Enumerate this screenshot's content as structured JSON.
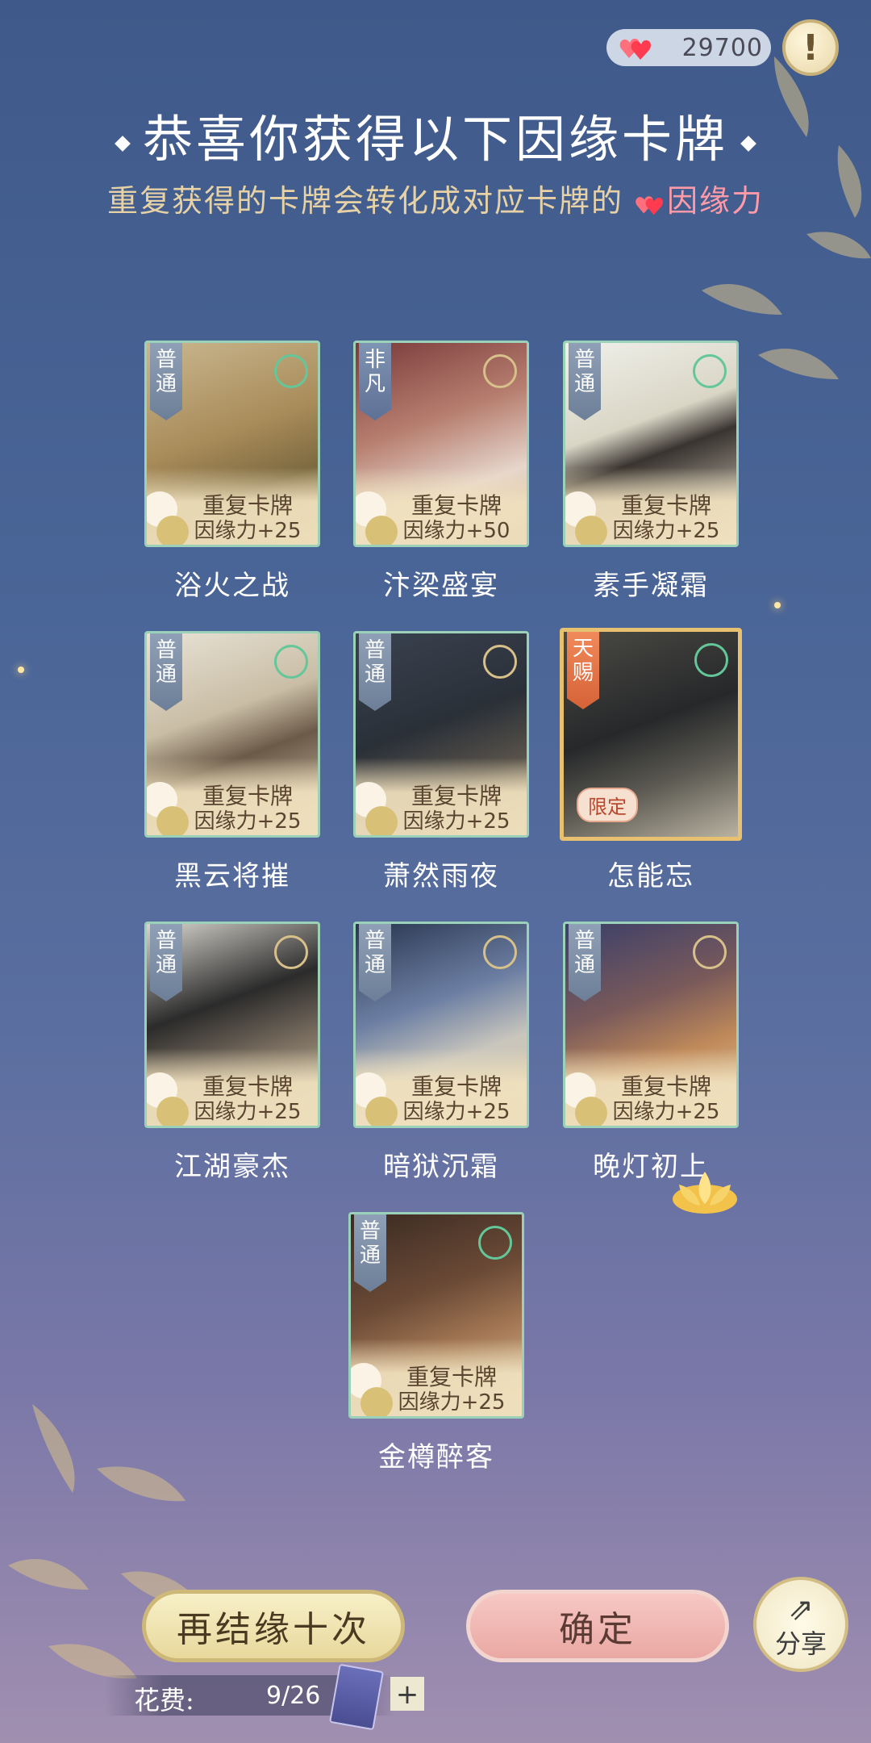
{
  "currency": {
    "value": "29700"
  },
  "info_button": {
    "label": "!"
  },
  "header": {
    "title": "恭喜你获得以下因缘卡牌",
    "subtitle_pre": "重复获得的卡牌会转化成对应卡牌的",
    "subtitle_highlight": "因缘力"
  },
  "cards": [
    {
      "rank": "普通",
      "dup_label": "重复卡牌",
      "bonus": "因缘力+25",
      "name": "浴火之战",
      "emblem": "sword-icon"
    },
    {
      "rank": "非凡",
      "dup_label": "重复卡牌",
      "bonus": "因缘力+50",
      "name": "汴梁盛宴",
      "emblem": "coin-icon"
    },
    {
      "rank": "普通",
      "dup_label": "重复卡牌",
      "bonus": "因缘力+25",
      "name": "素手凝霜",
      "emblem": "sword-icon"
    },
    {
      "rank": "普通",
      "dup_label": "重复卡牌",
      "bonus": "因缘力+25",
      "name": "黑云将摧",
      "emblem": "sword-icon"
    },
    {
      "rank": "普通",
      "dup_label": "重复卡牌",
      "bonus": "因缘力+25",
      "name": "萧然雨夜",
      "emblem": "coin-icon"
    },
    {
      "rank": "天赐",
      "badge": "限定",
      "name": "怎能忘",
      "emblem": "sword-icon"
    },
    {
      "rank": "普通",
      "dup_label": "重复卡牌",
      "bonus": "因缘力+25",
      "name": "江湖豪杰",
      "emblem": "coin-icon"
    },
    {
      "rank": "普通",
      "dup_label": "重复卡牌",
      "bonus": "因缘力+25",
      "name": "暗狱沉霜",
      "emblem": "coin-icon"
    },
    {
      "rank": "普通",
      "dup_label": "重复卡牌",
      "bonus": "因缘力+25",
      "name": "晚灯初上",
      "emblem": "coin-icon"
    },
    {
      "rank": "普通",
      "dup_label": "重复卡牌",
      "bonus": "因缘力+25",
      "name": "金樽醉客",
      "emblem": "sword-icon"
    }
  ],
  "buttons": {
    "again": "再结缘十次",
    "confirm": "确定",
    "share": "分享"
  },
  "cost": {
    "label": "花费:",
    "value": "9/26"
  },
  "colors": {
    "accent_pink": "#ff9aa8",
    "gold": "#e7d2a6"
  }
}
